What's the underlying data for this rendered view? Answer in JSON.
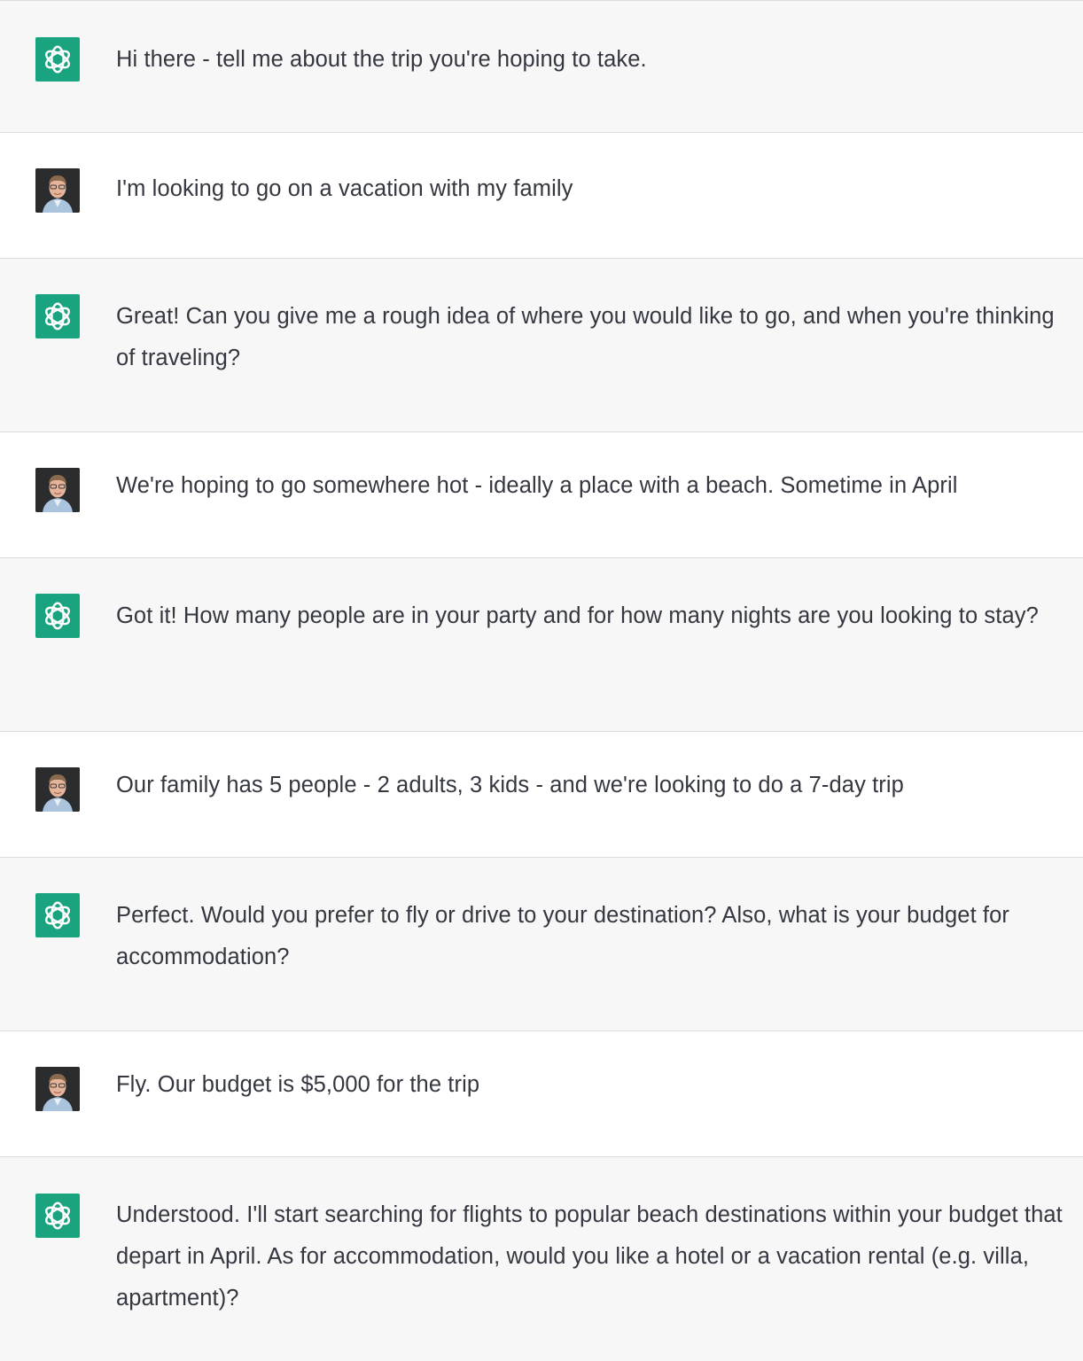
{
  "conversation": {
    "messages": [
      {
        "role": "assistant",
        "text": "Hi there - tell me about the trip you're hoping to take."
      },
      {
        "role": "user",
        "text": "I'm looking to go on a vacation with my family"
      },
      {
        "role": "assistant",
        "text": "Great! Can you give me a rough idea of where you would like to go, and when you're thinking of traveling?"
      },
      {
        "role": "user",
        "text": "We're hoping to go somewhere hot - ideally a place with a beach. Sometime in April"
      },
      {
        "role": "assistant",
        "text": "Got it! How many people are in your party and for how many nights are you looking to stay?"
      },
      {
        "role": "user",
        "text": "Our family has 5 people - 2 adults, 3 kids - and we're looking to do a 7-day trip"
      },
      {
        "role": "assistant",
        "text": "Perfect. Would you prefer to fly or drive to your destination? Also, what is your budget for accommodation?"
      },
      {
        "role": "user",
        "text": "Fly. Our budget is $5,000 for the trip"
      },
      {
        "role": "assistant",
        "text": "Understood. I'll start searching for flights to popular beach destinations within your budget that depart in April. As for accommodation, would you like a hotel or a vacation rental (e.g. villa, apartment)?"
      }
    ]
  },
  "icons": {
    "assistant_avatar": "openai-logo-icon",
    "user_avatar": "user-photo-avatar"
  },
  "colors": {
    "assistant_bg": "#f7f7f8",
    "user_bg": "#ffffff",
    "assistant_avatar_bg": "#19a37f",
    "text": "#353740",
    "divider": "#dcdce0"
  }
}
